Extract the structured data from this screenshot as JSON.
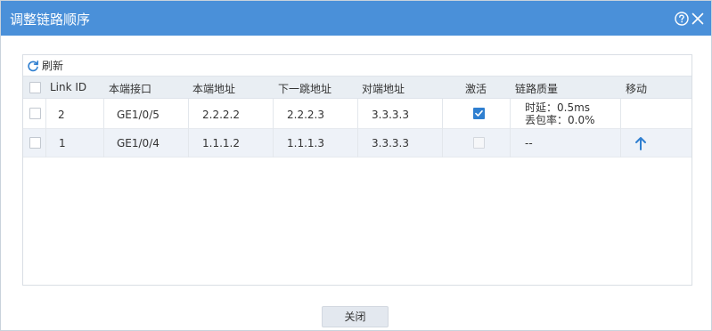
{
  "dialog": {
    "title": "调整链路顺序",
    "help_icon": "help-icon",
    "close_icon": "close-icon"
  },
  "toolbar": {
    "refresh_label": "刷新",
    "refresh_icon": "refresh-icon"
  },
  "table": {
    "columns": [
      "Link ID",
      "本端接口",
      "本端地址",
      "下一跳地址",
      "对端地址",
      "激活",
      "链路质量",
      "移动"
    ],
    "rows": [
      {
        "link_id": "2",
        "local_interface": "GE1/0/5",
        "local_address": "2.2.2.2",
        "next_hop": "2.2.2.3",
        "peer_address": "3.3.3.3",
        "active": true,
        "quality_line1": "时延：0.5ms",
        "quality_line2": "丢包率：0.0%"
      },
      {
        "link_id": "1",
        "local_interface": "GE1/0/4",
        "local_address": "1.1.1.2",
        "next_hop": "1.1.1.3",
        "peer_address": "3.3.3.3",
        "active": false,
        "quality_line1": "--",
        "move_icon": "arrow-up-icon"
      }
    ]
  },
  "footer": {
    "close_label": "关闭"
  },
  "colors": {
    "titlebar": "#4a90d9",
    "accent": "#2f7fd0",
    "header_bg": "#e9eef3",
    "row_alt_bg": "#eef2f8"
  }
}
